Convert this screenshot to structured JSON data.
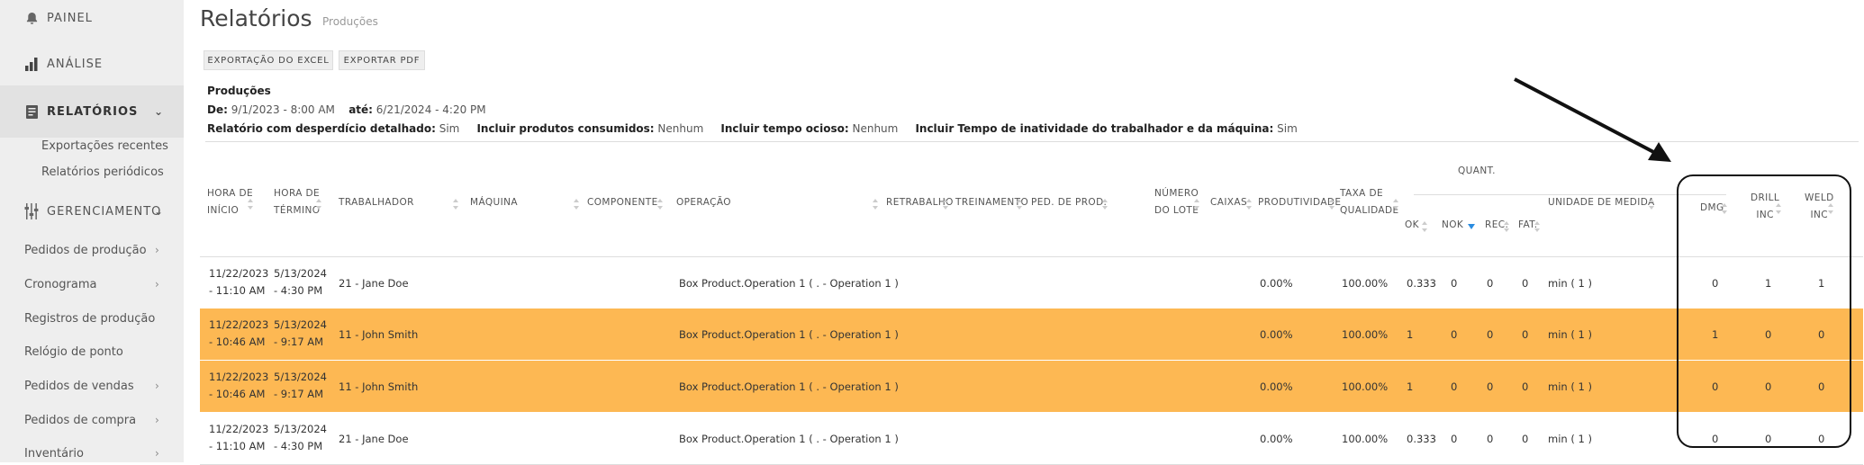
{
  "sidebar": {
    "top_items": [
      {
        "label": "PAINEL",
        "icon": "bell-icon"
      },
      {
        "label": "ANÁLISE",
        "icon": "bar-chart-icon"
      },
      {
        "label": "RELATÓRIOS",
        "icon": "report-icon"
      }
    ],
    "relatorios_sub": [
      "Exportações recentes",
      "Relatórios periódicos"
    ],
    "gerenciamento": "GERENCIAMENTO",
    "manage_items": [
      "Pedidos de produção",
      "Cronograma",
      "Registros de produção",
      "Relógio de ponto",
      "Pedidos de vendas",
      "Pedidos de compra",
      "Inventário"
    ]
  },
  "page": {
    "title": "Relatórios",
    "subtitle": "Produções"
  },
  "buttons": {
    "excel": "EXPORTAÇÃO DO EXCEL",
    "pdf": "EXPORTAR PDF"
  },
  "info": {
    "heading": "Produções",
    "de_label": "De:",
    "de_value": "9/1/2023 - 8:00 AM",
    "ate_label": "até:",
    "ate_value": "6/21/2024 - 4:20 PM",
    "f1_label": "Relatório com desperdício detalhado:",
    "f1_value": "Sim",
    "f2_label": "Incluir produtos consumidos:",
    "f2_value": "Nenhum",
    "f3_label": "Incluir tempo ocioso:",
    "f3_value": "Nenhum",
    "f4_label": "Incluir Tempo de inatividade do trabalhador e da máquina:",
    "f4_value": "Sim"
  },
  "table": {
    "group_quant": "QUANT.",
    "headers": {
      "inicio": [
        "HORA DE",
        "INÍCIO"
      ],
      "termino": [
        "HORA DE",
        "TÉRMINO"
      ],
      "trabalhador": "TRABALHADOR",
      "maquina": "MÁQUINA",
      "componente": "COMPONENTE",
      "operacao": "OPERAÇÃO",
      "retrabalho": "RETRABALHO",
      "treinamento": "TREINAMENTO",
      "ped": "PED. DE PROD.",
      "lote": [
        "NÚMERO",
        "DO LOTE"
      ],
      "caixas": "CAIXAS",
      "produtividade": "PRODUTIVIDADE",
      "taxa": [
        "TAXA DE",
        "QUALIDADE"
      ],
      "ok": "OK",
      "nok": "NOK",
      "rec": "REC.",
      "fat": "FAT.",
      "unidade": "UNIDADE DE MEDIDA",
      "dmg": "DMG",
      "drill": [
        "DRILL",
        "INC"
      ],
      "weld": [
        "WELD",
        "INC"
      ]
    },
    "rows": [
      {
        "start": [
          "11/22/2023",
          "- 11:10 AM"
        ],
        "end": [
          "5/13/2024",
          "- 4:30 PM"
        ],
        "worker": "21 - Jane Doe",
        "operation": "Box Product.Operation 1 ( . - Operation 1 )",
        "prod": "0.00%",
        "quality": "100.00%",
        "ok": "0.333",
        "nok": "0",
        "rec": "0",
        "fat": "0",
        "unit": "min ( 1 )",
        "dmg": "0",
        "drill": "1",
        "weld": "1",
        "highlight": false
      },
      {
        "start": [
          "11/22/2023",
          "- 10:46 AM"
        ],
        "end": [
          "5/13/2024",
          "- 9:17 AM"
        ],
        "worker": "11 - John Smith",
        "operation": "Box Product.Operation 1 ( . - Operation 1 )",
        "prod": "0.00%",
        "quality": "100.00%",
        "ok": "1",
        "nok": "0",
        "rec": "0",
        "fat": "0",
        "unit": "min ( 1 )",
        "dmg": "1",
        "drill": "0",
        "weld": "0",
        "highlight": true
      },
      {
        "start": [
          "11/22/2023",
          "- 10:46 AM"
        ],
        "end": [
          "5/13/2024",
          "- 9:17 AM"
        ],
        "worker": "11 - John Smith",
        "operation": "Box Product.Operation 1 ( . - Operation 1 )",
        "prod": "0.00%",
        "quality": "100.00%",
        "ok": "1",
        "nok": "0",
        "rec": "0",
        "fat": "0",
        "unit": "min ( 1 )",
        "dmg": "0",
        "drill": "0",
        "weld": "0",
        "highlight": true
      },
      {
        "start": [
          "11/22/2023",
          "- 11:10 AM"
        ],
        "end": [
          "5/13/2024",
          "- 4:30 PM"
        ],
        "worker": "21 - Jane Doe",
        "operation": "Box Product.Operation 1 ( . - Operation 1 )",
        "prod": "0.00%",
        "quality": "100.00%",
        "ok": "0.333",
        "nok": "0",
        "rec": "0",
        "fat": "0",
        "unit": "min ( 1 )",
        "dmg": "0",
        "drill": "0",
        "weld": "0",
        "highlight": false
      }
    ]
  },
  "colors": {
    "highlight_row": "#fdb853",
    "sidebar_bg": "#eeeeee",
    "sort_active": "#2a8ce0"
  }
}
